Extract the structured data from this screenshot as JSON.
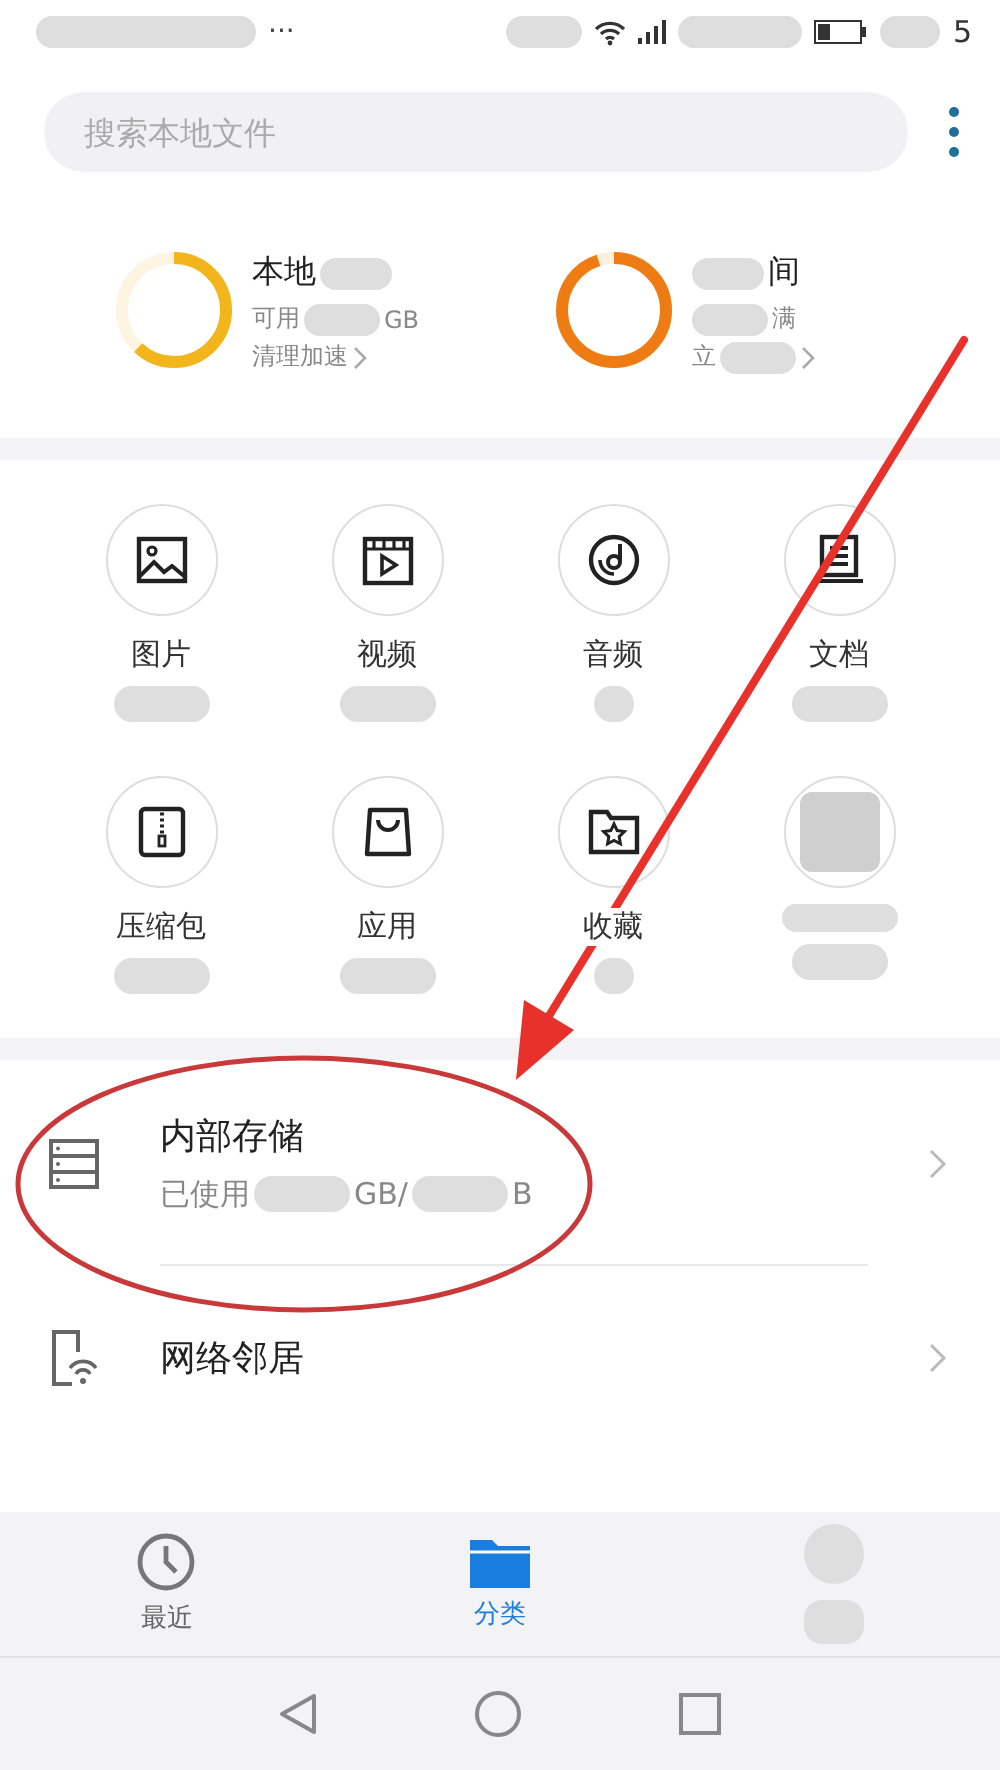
{
  "status_bar": {
    "overflow": "···",
    "time_end": "5",
    "battery": {
      "level": 0.3
    }
  },
  "search": {
    "placeholder": "搜索本地文件"
  },
  "storage": [
    {
      "level": 0.62,
      "color": "#f2b51c",
      "lines": [
        [
          {
            "kind": "text",
            "text": "本地"
          },
          {
            "kind": "blur"
          }
        ],
        [
          {
            "kind": "text",
            "text": "可用"
          },
          {
            "kind": "blur"
          },
          {
            "kind": "text",
            "text": "GB"
          }
        ],
        [
          {
            "kind": "text",
            "text": "清理加速"
          },
          {
            "kind": "chevron"
          }
        ]
      ]
    },
    {
      "level": 0.95,
      "color": "#ef7c12",
      "lines": [
        [
          {
            "kind": "blur"
          },
          {
            "kind": "text",
            "text": "间"
          }
        ],
        [
          {
            "kind": "blur"
          },
          {
            "kind": "text",
            "text": "满"
          }
        ],
        [
          {
            "kind": "text",
            "text": "立"
          },
          {
            "kind": "blur"
          },
          {
            "kind": "chevron"
          }
        ]
      ]
    }
  ],
  "categories": [
    {
      "kind": "image",
      "label": "图片"
    },
    {
      "kind": "video",
      "label": "视频"
    },
    {
      "kind": "music",
      "label": "音频"
    },
    {
      "kind": "document",
      "label": "文档"
    },
    {
      "kind": "zip",
      "label": "压缩包"
    },
    {
      "kind": "bag",
      "label": "应用"
    },
    {
      "kind": "favorite",
      "label": "收藏"
    },
    {
      "kind": "blur"
    }
  ],
  "locations": [
    {
      "kind": "storage",
      "title": "内部存储",
      "subtitle": [
        {
          "kind": "text",
          "text": "已使用"
        },
        {
          "kind": "blur"
        },
        {
          "kind": "text",
          "text": "GB/"
        },
        {
          "kind": "blur"
        },
        {
          "kind": "text",
          "text": "B"
        }
      ]
    },
    {
      "kind": "network",
      "title": "网络邻居"
    }
  ],
  "bottom_nav": [
    {
      "kind": "clock",
      "label": "最近",
      "selected": false
    },
    {
      "kind": "folder",
      "label": "分类",
      "selected": true
    },
    {
      "kind": "blur",
      "selected": false
    }
  ]
}
